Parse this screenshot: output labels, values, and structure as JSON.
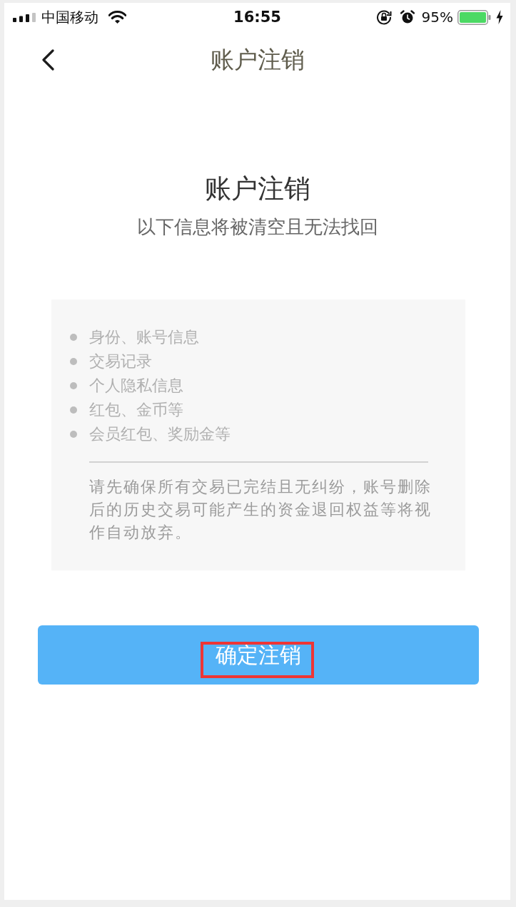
{
  "status_bar": {
    "carrier": "中国移动",
    "time": "16:55",
    "battery": "95%"
  },
  "nav_bar": {
    "title": "账户注销"
  },
  "heading": {
    "title": "账户注销",
    "subtitle": "以下信息将被清空且无法找回"
  },
  "info_card": {
    "items": [
      "身份、账号信息",
      "交易记录",
      "个人隐私信息",
      "红包、金币等",
      "会员红包、奖励金等"
    ],
    "note": "请先确保所有交易已完结且无纠纷，账号删除后的历史交易可能产生的资金退回权益等将视作自动放弃。"
  },
  "confirm_button": {
    "label": "确定注销",
    "highlighted": true
  }
}
